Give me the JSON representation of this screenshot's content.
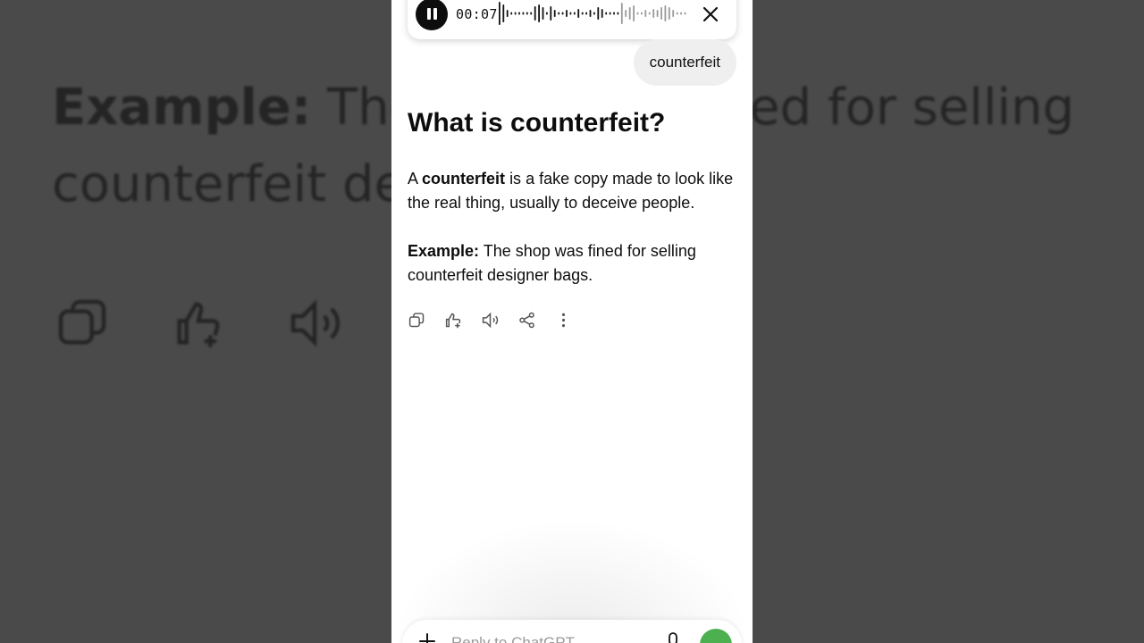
{
  "background": {
    "label": "Example:",
    "sentence": "The shop was fined for selling counterfeit designer bags."
  },
  "voice_bar": {
    "timer": "00:07"
  },
  "conversation": {
    "user_message": "counterfeit",
    "title": "What is counterfeit?",
    "definition_prefix": "A",
    "definition_term": "counterfeit",
    "definition_rest": "is a fake copy made to look like the real thing, usually to deceive people.",
    "example_label": "Example:",
    "example_text": "The shop was fined for selling counterfeit designer bags."
  },
  "actions": {
    "icons": [
      "copy-icon",
      "thumbs-up-icon",
      "speaker-icon",
      "share-icon",
      "more-icon"
    ]
  },
  "composer": {
    "placeholder": "Reply to ChatGPT"
  },
  "colors": {
    "backdrop": "#4a4a4a",
    "voice_button": "#4caf50",
    "text": "#0d0d0d"
  }
}
